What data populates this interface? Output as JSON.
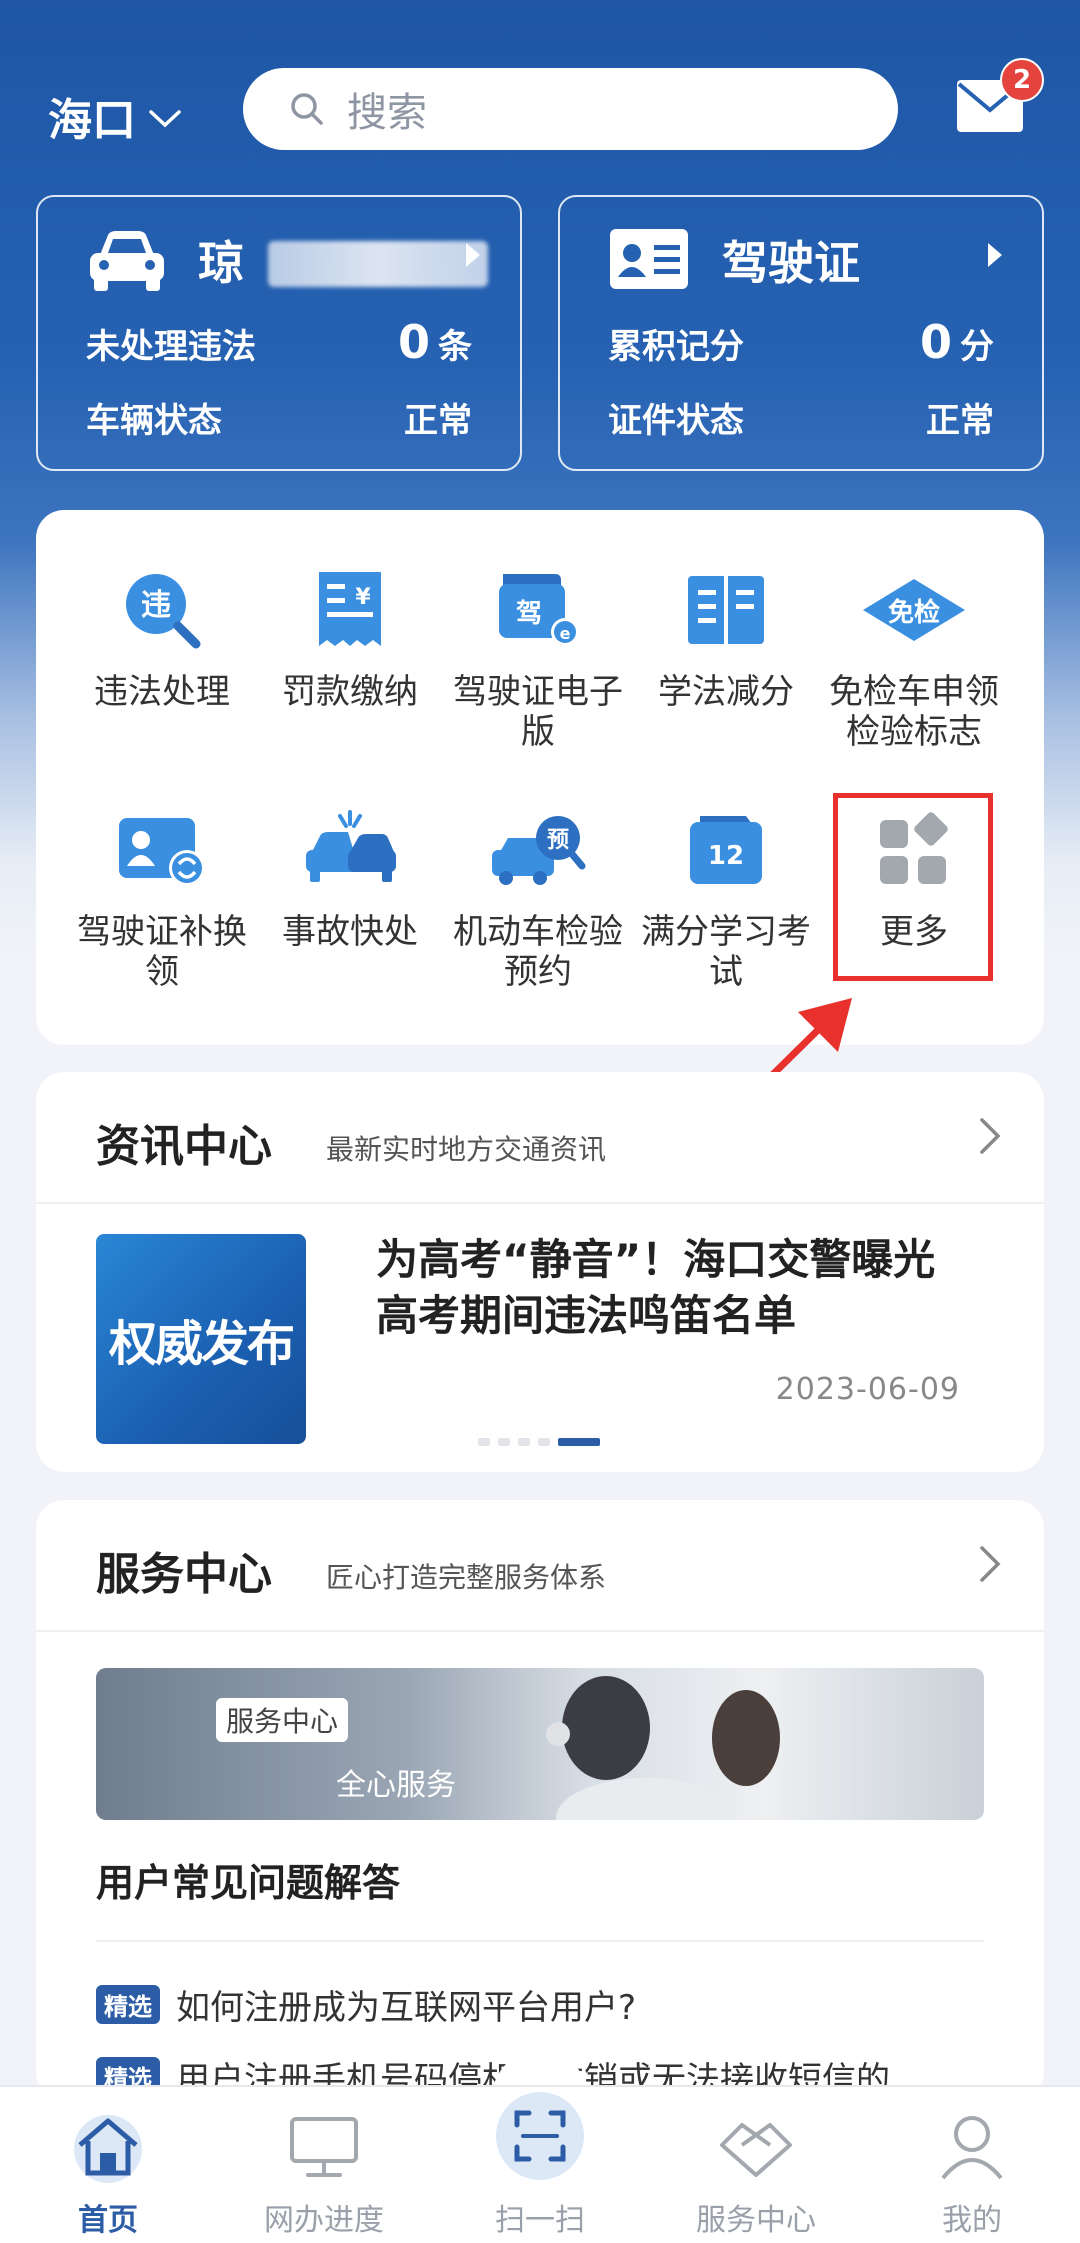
{
  "header": {
    "city": "海口",
    "search_placeholder": "搜索",
    "unread_count": "2"
  },
  "vehicle_card": {
    "title": "琼",
    "row1_label": "未处理违法",
    "row1_value": "0",
    "row1_unit": "条",
    "row2_label": "车辆状态",
    "row2_value": "正常"
  },
  "license_card": {
    "title": "驾驶证",
    "row1_label": "累积记分",
    "row1_value": "0",
    "row1_unit": "分",
    "row2_label": "证件状态",
    "row2_value": "正常"
  },
  "services": [
    {
      "label": "违法处理",
      "icon": "violation-search-icon"
    },
    {
      "label": "罚款缴纳",
      "icon": "fine-bill-icon"
    },
    {
      "label": "驾驶证电子版",
      "icon": "e-license-icon"
    },
    {
      "label": "学法减分",
      "icon": "book-icon"
    },
    {
      "label": "免检车申领检验标志",
      "icon": "exempt-badge-icon"
    },
    {
      "label": "驾驶证补换领",
      "icon": "license-renew-icon"
    },
    {
      "label": "事故快处",
      "icon": "accident-icon"
    },
    {
      "label": "机动车检验预约",
      "icon": "inspection-booking-icon"
    },
    {
      "label": "满分学习考试",
      "icon": "calendar-icon"
    },
    {
      "label": "更多",
      "icon": "more-grid-icon"
    }
  ],
  "news": {
    "title": "资讯中心",
    "subtitle": "最新实时地方交通资讯",
    "image_text": "权威发布",
    "headline": "为高考“静音”！海口交警曝光高考期间违法鸣笛名单",
    "date": "2023-06-09"
  },
  "service_center": {
    "title": "服务中心",
    "subtitle": "匠心打造完整服务体系",
    "banner_tag": "服务中心",
    "banner_motto": "全心服务",
    "faq_title": "用户常见问题解答",
    "faq_badge": "精选",
    "faq_items": [
      "如何注册成为互联网平台用户?",
      "用户注册手机号码停机、注销或无法接收短信的"
    ]
  },
  "tabs": [
    {
      "label": "首页",
      "icon": "home-icon",
      "active": true
    },
    {
      "label": "网办进度",
      "icon": "monitor-icon"
    },
    {
      "label": "扫一扫",
      "icon": "scan-icon"
    },
    {
      "label": "服务中心",
      "icon": "handshake-icon"
    },
    {
      "label": "我的",
      "icon": "user-icon"
    }
  ],
  "colors": {
    "brand_blue": "#2d5ca6",
    "highlight_red": "#e8312c"
  }
}
